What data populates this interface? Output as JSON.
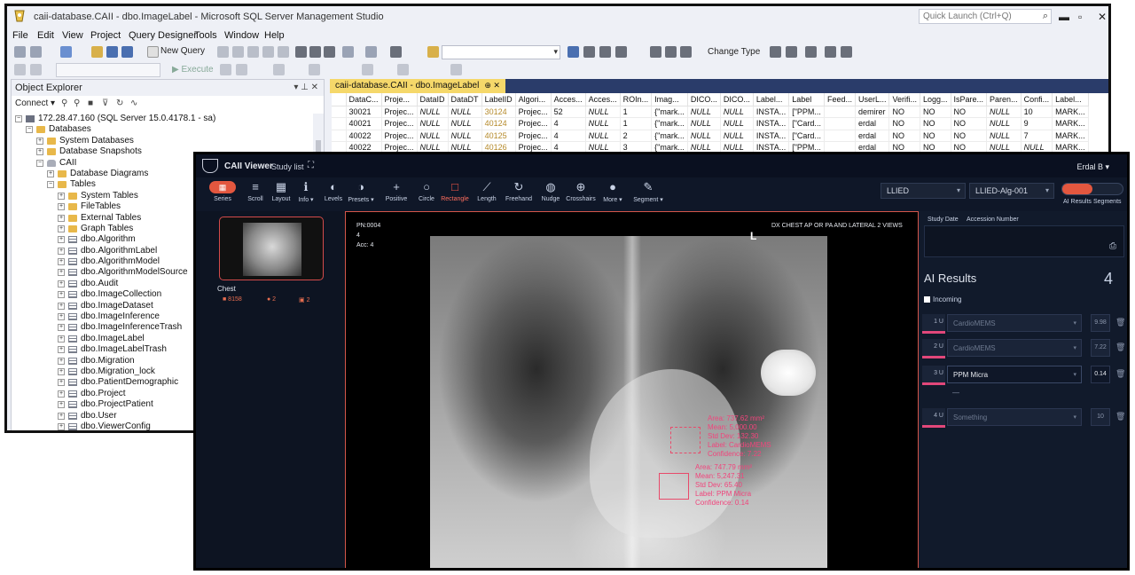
{
  "ssms": {
    "title": "caii-database.CAII - dbo.ImageLabel - Microsoft SQL Server Management Studio",
    "quick_launch_placeholder": "Quick Launch (Ctrl+Q)",
    "menu": [
      "File",
      "Edit",
      "View",
      "Project",
      "Query Designer",
      "Tools",
      "Window",
      "Help"
    ],
    "toolbar": {
      "new_query": "New Query",
      "change_type": "Change Type",
      "execute": "Execute"
    },
    "object_explorer": {
      "title": "Object Explorer",
      "connect_label": "Connect",
      "tree": [
        {
          "label": "172.28.47.160 (SQL Server 15.0.4178.1 - sa)",
          "indent": 0,
          "icon": "server-icon",
          "expander": "−"
        },
        {
          "label": "Databases",
          "indent": 1,
          "icon": "folder-icon",
          "expander": "−"
        },
        {
          "label": "System Databases",
          "indent": 2,
          "icon": "folder-icon",
          "expander": "+"
        },
        {
          "label": "Database Snapshots",
          "indent": 2,
          "icon": "folder-icon",
          "expander": "+"
        },
        {
          "label": "CAII",
          "indent": 2,
          "icon": "database-icon",
          "expander": "−"
        },
        {
          "label": "Database Diagrams",
          "indent": 3,
          "icon": "folder-icon",
          "expander": "+"
        },
        {
          "label": "Tables",
          "indent": 3,
          "icon": "folder-icon",
          "expander": "−"
        },
        {
          "label": "System Tables",
          "indent": 4,
          "icon": "folder-icon",
          "expander": "+"
        },
        {
          "label": "FileTables",
          "indent": 4,
          "icon": "folder-icon",
          "expander": "+"
        },
        {
          "label": "External Tables",
          "indent": 4,
          "icon": "folder-icon",
          "expander": "+"
        },
        {
          "label": "Graph Tables",
          "indent": 4,
          "icon": "folder-icon",
          "expander": "+"
        },
        {
          "label": "dbo.Algorithm",
          "indent": 4,
          "icon": "table-icon",
          "expander": "+"
        },
        {
          "label": "dbo.AlgorithmLabel",
          "indent": 4,
          "icon": "table-icon",
          "expander": "+"
        },
        {
          "label": "dbo.AlgorithmModel",
          "indent": 4,
          "icon": "table-icon",
          "expander": "+"
        },
        {
          "label": "dbo.AlgorithmModelSource",
          "indent": 4,
          "icon": "table-icon",
          "expander": "+"
        },
        {
          "label": "dbo.Audit",
          "indent": 4,
          "icon": "table-icon",
          "expander": "+"
        },
        {
          "label": "dbo.ImageCollection",
          "indent": 4,
          "icon": "table-icon",
          "expander": "+"
        },
        {
          "label": "dbo.ImageDataset",
          "indent": 4,
          "icon": "table-icon",
          "expander": "+"
        },
        {
          "label": "dbo.ImageInference",
          "indent": 4,
          "icon": "table-icon",
          "expander": "+"
        },
        {
          "label": "dbo.ImageInferenceTrash",
          "indent": 4,
          "icon": "table-icon",
          "expander": "+"
        },
        {
          "label": "dbo.ImageLabel",
          "indent": 4,
          "icon": "table-icon",
          "expander": "+"
        },
        {
          "label": "dbo.ImageLabelTrash",
          "indent": 4,
          "icon": "table-icon",
          "expander": "+"
        },
        {
          "label": "dbo.Migration",
          "indent": 4,
          "icon": "table-icon",
          "expander": "+"
        },
        {
          "label": "dbo.Migration_lock",
          "indent": 4,
          "icon": "table-icon",
          "expander": "+"
        },
        {
          "label": "dbo.PatientDemographic",
          "indent": 4,
          "icon": "table-icon",
          "expander": "+"
        },
        {
          "label": "dbo.Project",
          "indent": 4,
          "icon": "table-icon",
          "expander": "+"
        },
        {
          "label": "dbo.ProjectPatient",
          "indent": 4,
          "icon": "table-icon",
          "expander": "+"
        },
        {
          "label": "dbo.User",
          "indent": 4,
          "icon": "table-icon",
          "expander": "+"
        },
        {
          "label": "dbo.ViewerConfig",
          "indent": 4,
          "icon": "table-icon",
          "expander": "+"
        }
      ]
    },
    "query_tab": "caii-database.CAII - dbo.ImageLabel",
    "results": {
      "columns": [
        "DataC...",
        "Proje...",
        "DataID",
        "DataDT",
        "LabelID",
        "Algori...",
        "Acces...",
        "Acces...",
        "ROIn...",
        "Imag...",
        "DICO...",
        "DICO...",
        "Label...",
        "Label",
        "Feed...",
        "UserL...",
        "Verifi...",
        "Logg...",
        "IsPare...",
        "Paren...",
        "Confi...",
        "Label..."
      ],
      "rows": [
        [
          "30021",
          "Projec...",
          "NULL",
          "NULL",
          "30124",
          "Projec...",
          "52",
          "NULL",
          "1",
          "{\"mark...",
          "NULL",
          "NULL",
          "INSTA...",
          "[\"PPM...",
          "",
          "demirer",
          "NO",
          "NO",
          "NO",
          "NULL",
          "10",
          "MARK..."
        ],
        [
          "40021",
          "Projec...",
          "NULL",
          "NULL",
          "40124",
          "Projec...",
          "4",
          "NULL",
          "1",
          "{\"mark...",
          "NULL",
          "NULL",
          "INSTA...",
          "[\"Card...",
          "",
          "erdal",
          "NO",
          "NO",
          "NO",
          "NULL",
          "9",
          "MARK..."
        ],
        [
          "40022",
          "Projec...",
          "NULL",
          "NULL",
          "40125",
          "Projec...",
          "4",
          "NULL",
          "2",
          "{\"mark...",
          "NULL",
          "NULL",
          "INSTA...",
          "[\"Card...",
          "",
          "erdal",
          "NO",
          "NO",
          "NO",
          "NULL",
          "7",
          "MARK..."
        ],
        [
          "40022",
          "Projec...",
          "NULL",
          "NULL",
          "40126",
          "Projec...",
          "4",
          "NULL",
          "3",
          "{\"mark...",
          "NULL",
          "NULL",
          "INSTA...",
          "[\"PPM...",
          "",
          "erdal",
          "NO",
          "NO",
          "NO",
          "NULL",
          "NULL",
          "MARK..."
        ]
      ]
    }
  },
  "viewer": {
    "app_name": "CAII Viewer",
    "study_list": "Study list",
    "user": "Erdal B",
    "tools": [
      {
        "label": "Series",
        "icon": "series-icon",
        "glyph": "▦",
        "active": true
      },
      {
        "label": "Scroll",
        "icon": "scroll-icon",
        "glyph": "≡",
        "active": false
      },
      {
        "label": "Layout",
        "icon": "layout-icon",
        "glyph": "▦",
        "active": false
      },
      {
        "label": "Info ▾",
        "icon": "info-icon",
        "glyph": "ℹ",
        "active": false
      },
      {
        "label": "Levels",
        "icon": "levels-icon",
        "glyph": "◐",
        "active": false
      },
      {
        "label": "Presets ▾",
        "icon": "presets-icon",
        "glyph": "◑",
        "active": false
      },
      {
        "label": "Positive",
        "icon": "plus-icon",
        "glyph": "+",
        "active": false
      },
      {
        "label": "Circle",
        "icon": "circle-icon",
        "glyph": "○",
        "active": false
      },
      {
        "label": "Rectangle",
        "icon": "rectangle-icon",
        "glyph": "□",
        "active": true
      },
      {
        "label": "Length",
        "icon": "ruler-icon",
        "glyph": "⟋",
        "active": false
      },
      {
        "label": "Freehand",
        "icon": "freehand-icon",
        "glyph": "↻",
        "active": false
      },
      {
        "label": "Nudge",
        "icon": "nudge-icon",
        "glyph": "◍",
        "active": false
      },
      {
        "label": "Crosshairs",
        "icon": "crosshairs-icon",
        "glyph": "⊕",
        "active": false
      },
      {
        "label": "More ▾",
        "icon": "more-icon",
        "glyph": "●",
        "active": false
      },
      {
        "label": "Segment ▾",
        "icon": "brush-icon",
        "glyph": "✎",
        "active": false
      }
    ],
    "dropdown1": "LLIED",
    "dropdown2": "LLIED-Alg-001",
    "toggle_left": "AI Results",
    "toggle_right": "Segments",
    "series": {
      "name": "Chest",
      "stat1": "■ 8158",
      "stat2": "● 2",
      "stat3": "2"
    },
    "viewport": {
      "pn": "PN:0004",
      "line2": "4",
      "acc": "Acc: 4",
      "description": "DX CHEST AP OR PA AND LATERAL 2 VIEWS",
      "orientation": "L",
      "roi1": {
        "area": "Area: 737.62 mm²",
        "mean": "Mean: 5,000.00",
        "std": "Std Dev: 132.30",
        "label": "Label: CardioMEMS",
        "confidence": "Confidence: 7.22"
      },
      "roi2": {
        "area": "Area: 747.79 mm²",
        "mean": "Mean: 5,247.31",
        "std": "Std Dev: 65.40",
        "label": "Label: PPM Micra",
        "confidence": "Confidence: 0.14"
      }
    },
    "ai": {
      "col1": "Study Date",
      "col2": "Accession Number",
      "title": "AI Results",
      "count": "4",
      "incoming": "Incoming",
      "rows": [
        {
          "num": "1 U",
          "label": "CardioMEMS",
          "conf": "9.98",
          "active": false
        },
        {
          "num": "2 U",
          "label": "CardioMEMS",
          "conf": "7.22",
          "active": false
        },
        {
          "num": "3 U",
          "label": "PPM Micra",
          "conf": "0.14",
          "active": true
        },
        {
          "num": "4 U",
          "label": "Something",
          "conf": "10",
          "active": false
        }
      ],
      "row3_sub": "—"
    }
  }
}
